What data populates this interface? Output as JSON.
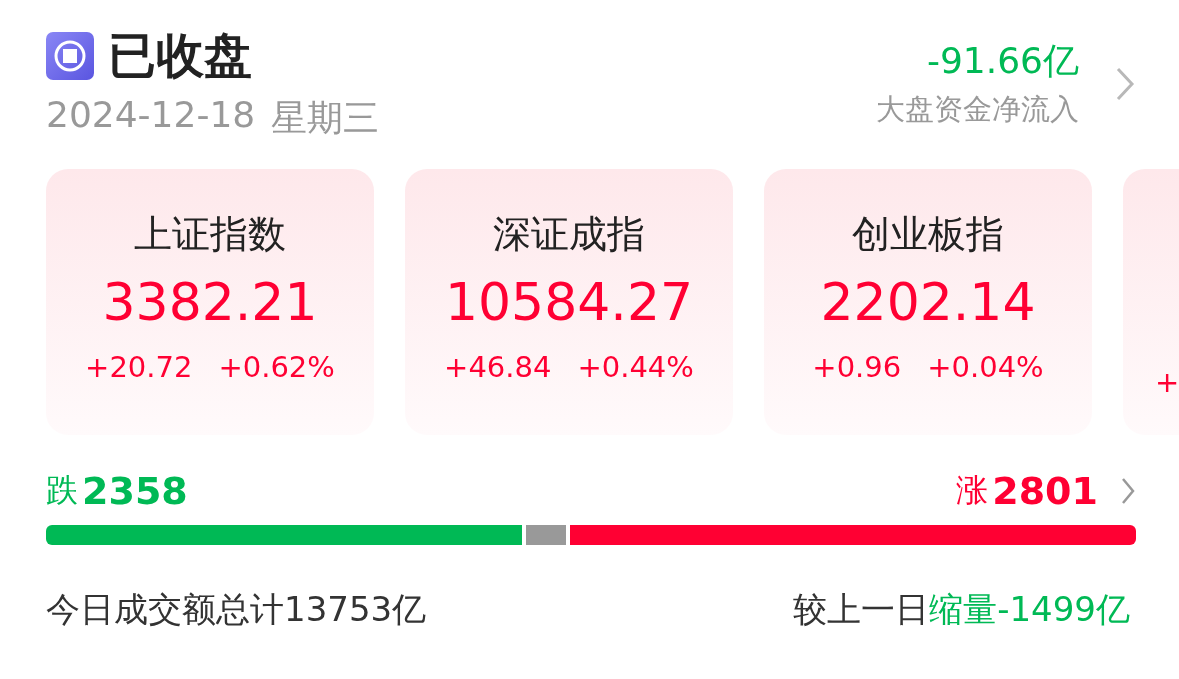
{
  "header": {
    "status": "已收盘",
    "date": "2024-12-18",
    "weekday": "星期三",
    "net_flow": "-91.66亿",
    "net_flow_label": "大盘资金净流入"
  },
  "indices": [
    {
      "name": "上证指数",
      "value": "3382.21",
      "change": "+20.72",
      "percent": "+0.62%"
    },
    {
      "name": "深证成指",
      "value": "10584.27",
      "change": "+46.84",
      "percent": "+0.44%"
    },
    {
      "name": "创业板指",
      "value": "2202.14",
      "change": "+0.96",
      "percent": "+0.04%"
    },
    {
      "change": "+"
    }
  ],
  "breadth": {
    "down_label": "跌",
    "down": "2358",
    "up_label": "涨",
    "up": "2801",
    "segments": [
      {
        "kind": "down"
      },
      {
        "kind": "flat"
      },
      {
        "kind": "up"
      }
    ]
  },
  "turnover": {
    "total": "今日成交额总计13753亿",
    "compare_label": "较上一日",
    "compare_dir": "缩量",
    "compare_value": "-1499亿"
  }
}
